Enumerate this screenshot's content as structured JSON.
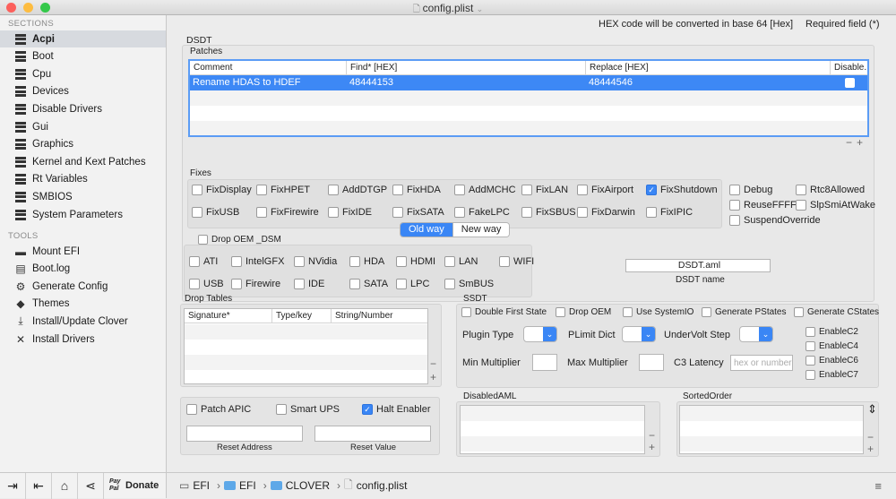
{
  "window": {
    "title": "config.plist",
    "close_color": "#fc605c",
    "min_color": "#fdbc40",
    "max_color": "#34c84a"
  },
  "sidebar": {
    "sections_label": "SECTIONS",
    "tools_label": "TOOLS",
    "sections": [
      {
        "label": "Acpi",
        "selected": true
      },
      {
        "label": "Boot"
      },
      {
        "label": "Cpu"
      },
      {
        "label": "Devices"
      },
      {
        "label": "Disable Drivers"
      },
      {
        "label": "Gui"
      },
      {
        "label": "Graphics"
      },
      {
        "label": "Kernel and Kext Patches"
      },
      {
        "label": "Rt Variables"
      },
      {
        "label": "SMBIOS"
      },
      {
        "label": "System Parameters"
      }
    ],
    "tools": [
      {
        "label": "Mount EFI",
        "icon": "disk-icon"
      },
      {
        "label": "Boot.log",
        "icon": "document-icon"
      },
      {
        "label": "Generate Config",
        "icon": "gear-icon"
      },
      {
        "label": "Themes",
        "icon": "palette-icon"
      },
      {
        "label": "Install/Update Clover",
        "icon": "download-icon"
      },
      {
        "label": "Install Drivers",
        "icon": "wrench-icon"
      }
    ],
    "footer": {
      "donate_label": "Donate",
      "paypal_label": "Pay Pal"
    }
  },
  "header": {
    "hex_note": "HEX code will be converted in base 64 [Hex]",
    "required_note": "Required field (*)"
  },
  "dsdt": {
    "title": "DSDT",
    "patches": {
      "title": "Patches",
      "columns": [
        "Comment",
        "Find* [HEX]",
        "Replace [HEX]",
        "Disable..."
      ],
      "rows": [
        {
          "comment": "Rename HDAS to HDEF",
          "find": "48444153",
          "replace": "48444546",
          "disabled": false
        }
      ]
    },
    "fixes_title": "Fixes",
    "fixes": [
      {
        "label": "FixDisplay",
        "checked": false
      },
      {
        "label": "FixHPET",
        "checked": false
      },
      {
        "label": "AddDTGP",
        "checked": false
      },
      {
        "label": "FixHDA",
        "checked": false
      },
      {
        "label": "AddMCHC",
        "checked": false
      },
      {
        "label": "FixLAN",
        "checked": false
      },
      {
        "label": "FixAirport",
        "checked": false
      },
      {
        "label": "FixShutdown",
        "checked": true
      },
      {
        "label": "FixUSB",
        "checked": false
      },
      {
        "label": "FixFirewire",
        "checked": false
      },
      {
        "label": "FixIDE",
        "checked": false
      },
      {
        "label": "FixSATA",
        "checked": false
      },
      {
        "label": "FakeLPC",
        "checked": false
      },
      {
        "label": "FixSBUS",
        "checked": false
      },
      {
        "label": "FixDarwin",
        "checked": false
      },
      {
        "label": "FixIPIC",
        "checked": false
      }
    ],
    "extra_fixes": [
      {
        "label": "Debug",
        "checked": false
      },
      {
        "label": "Rtc8Allowed",
        "checked": false
      },
      {
        "label": "ReuseFFFF",
        "checked": false
      },
      {
        "label": "SlpSmiAtWake",
        "checked": false
      },
      {
        "label": "SuspendOverride",
        "checked": false
      }
    ],
    "way": {
      "old": "Old way",
      "new": "New way",
      "selected": "Old way"
    },
    "drop_oem_dsm": {
      "label": "Drop OEM _DSM",
      "checked": false
    },
    "dsm": [
      {
        "label": "ATI"
      },
      {
        "label": "IntelGFX"
      },
      {
        "label": "NVidia"
      },
      {
        "label": "HDA"
      },
      {
        "label": "HDMI"
      },
      {
        "label": "LAN"
      },
      {
        "label": "WIFI"
      },
      {
        "label": "USB"
      },
      {
        "label": "Firewire"
      },
      {
        "label": "IDE"
      },
      {
        "label": "SATA"
      },
      {
        "label": "LPC"
      },
      {
        "label": "SmBUS"
      }
    ],
    "name_value": "DSDT.aml",
    "name_label": "DSDT name"
  },
  "drop_tables": {
    "title": "Drop Tables",
    "columns": [
      "Signature*",
      "Type/key",
      "String/Number"
    ]
  },
  "ssdt": {
    "title": "SSDT",
    "options": [
      {
        "label": "Double First State"
      },
      {
        "label": "Drop OEM"
      },
      {
        "label": "Use SystemIO"
      },
      {
        "label": "Generate PStates"
      },
      {
        "label": "Generate CStates"
      }
    ],
    "plugin_type_label": "Plugin Type",
    "plimit_dict_label": "PLimit Dict",
    "undervolt_step_label": "UnderVolt Step",
    "min_multiplier_label": "Min Multiplier",
    "max_multiplier_label": "Max Multiplier",
    "c3_latency_label": "C3 Latency",
    "c3_latency_placeholder": "hex or number",
    "enable_c": [
      {
        "label": "EnableC2"
      },
      {
        "label": "EnableC4"
      },
      {
        "label": "EnableC6"
      },
      {
        "label": "EnableC7"
      }
    ]
  },
  "misc": {
    "patch_apic": {
      "label": "Patch APIC",
      "checked": false
    },
    "smart_ups": {
      "label": "Smart UPS",
      "checked": false
    },
    "halt_enabler": {
      "label": "Halt Enabler",
      "checked": true
    },
    "reset_address_label": "Reset Address",
    "reset_value_label": "Reset Value"
  },
  "disabled_aml": {
    "title": "DisabledAML"
  },
  "sorted_order": {
    "title": "SortedOrder"
  },
  "breadcrumb": [
    "EFI",
    "EFI",
    "CLOVER",
    "config.plist"
  ],
  "colors": {
    "accent": "#3a86f5",
    "selection": "#3d88f5"
  }
}
